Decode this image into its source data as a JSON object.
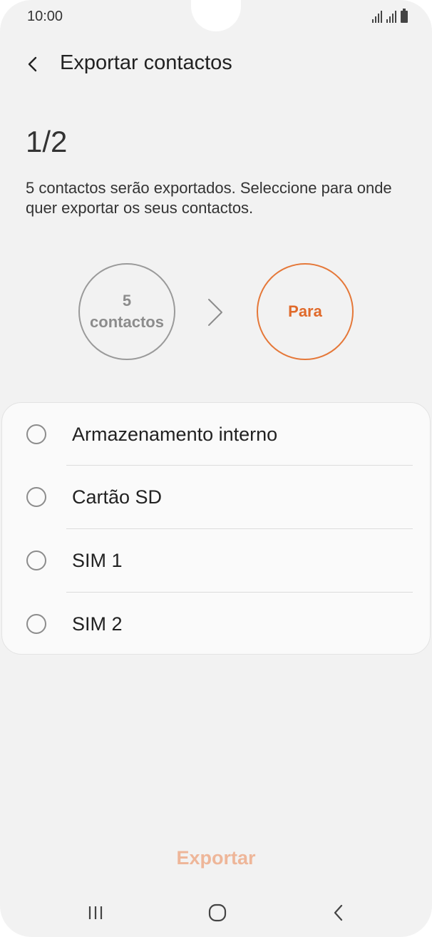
{
  "status_bar": {
    "time": "10:00",
    "icons": [
      "signal-sim1-icon",
      "signal-sim2-icon",
      "battery-icon"
    ]
  },
  "header": {
    "back_icon": "chevron-left-icon",
    "title": "Exportar contactos"
  },
  "step": "1/2",
  "description": "5 contactos serão exportados. Seleccione para onde quer exportar os seus contactos.",
  "flow": {
    "from_line1": "5",
    "from_line2": "contactos",
    "arrow_icon": "chevron-right-icon",
    "to_label": "Para"
  },
  "options": [
    {
      "label": "Armazenamento interno",
      "selected": false
    },
    {
      "label": "Cartão SD",
      "selected": false
    },
    {
      "label": "SIM 1",
      "selected": false
    },
    {
      "label": "SIM 2",
      "selected": false
    }
  ],
  "actions": {
    "export_label": "Exportar",
    "export_enabled": false
  },
  "nav_bar": {
    "items": [
      "recent-apps-icon",
      "home-icon",
      "back-icon"
    ]
  },
  "colors": {
    "accent": "#e57839",
    "accent_disabled": "#eeb699",
    "background": "#f2f2f2"
  }
}
